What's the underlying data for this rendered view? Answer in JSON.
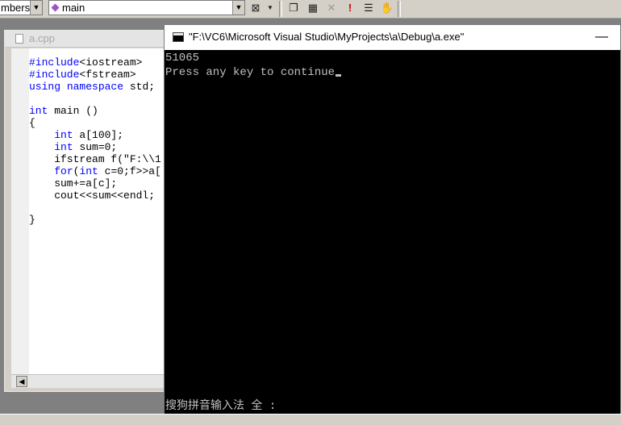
{
  "toolbar": {
    "class_combo": "mbers",
    "function_combo": "main",
    "icons": [
      "compile-icon",
      "build-icon",
      "stop-build-icon",
      "execute-icon",
      "go-icon",
      "insert-breakpoint-icon"
    ]
  },
  "editor": {
    "title": "a.cpp",
    "code_lines": [
      [
        {
          "t": "#include",
          "kw": true
        },
        {
          "t": "<iostream>"
        }
      ],
      [
        {
          "t": "#include",
          "kw": true
        },
        {
          "t": "<fstream>"
        }
      ],
      [
        {
          "t": "using",
          "kw": true
        },
        {
          "t": " "
        },
        {
          "t": "namespace",
          "kw": true
        },
        {
          "t": " std;"
        }
      ],
      [
        {
          "t": ""
        }
      ],
      [
        {
          "t": "int",
          "kw": true
        },
        {
          "t": " main ()"
        }
      ],
      [
        {
          "t": "{"
        }
      ],
      [
        {
          "t": "    "
        },
        {
          "t": "int",
          "kw": true
        },
        {
          "t": " a[100];"
        }
      ],
      [
        {
          "t": "    "
        },
        {
          "t": "int",
          "kw": true
        },
        {
          "t": " sum=0;"
        }
      ],
      [
        {
          "t": "    ifstream f(\"F:\\\\1"
        }
      ],
      [
        {
          "t": "    "
        },
        {
          "t": "for",
          "kw": true
        },
        {
          "t": "("
        },
        {
          "t": "int",
          "kw": true
        },
        {
          "t": " c=0;f>>a["
        }
      ],
      [
        {
          "t": "    sum+=a[c];"
        }
      ],
      [
        {
          "t": "    cout<<sum<<endl;"
        }
      ],
      [
        {
          "t": ""
        }
      ],
      [
        {
          "t": "}"
        }
      ]
    ]
  },
  "console": {
    "title": "\"F:\\VC6\\Microsoft Visual Studio\\MyProjects\\a\\Debug\\a.exe\"",
    "minimize_glyph": "—",
    "output_line1": "51065",
    "output_line2": "Press any key to continue",
    "ime_status": "搜狗拼音输入法 全 :"
  },
  "colors": {
    "keyword": "#0000ff",
    "console_bg": "#000000",
    "console_text": "#c0c0c0"
  }
}
